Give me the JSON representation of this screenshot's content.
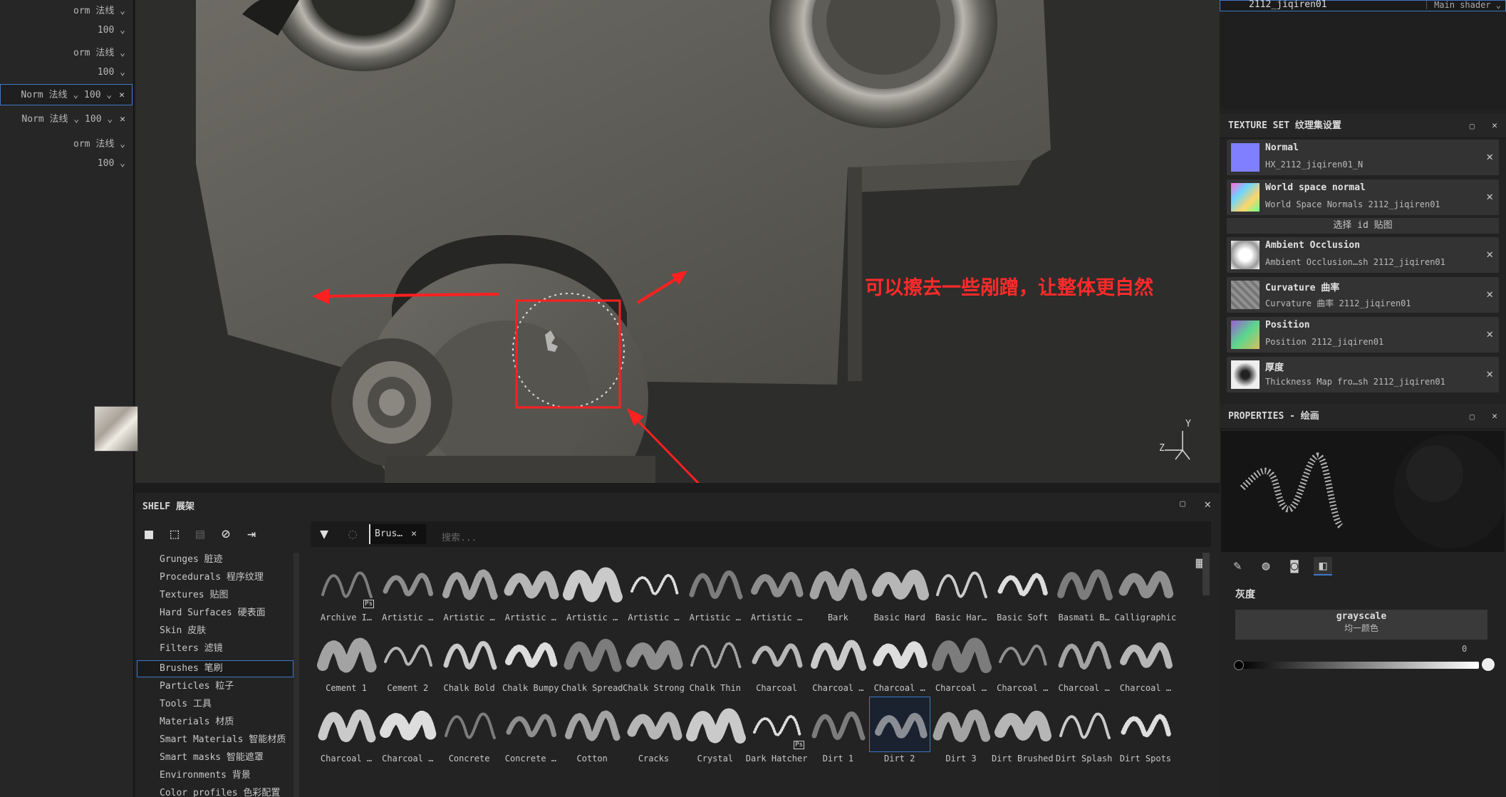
{
  "left_panel": {
    "rows": [
      {
        "text": "orm 法线 ⌄",
        "close": ""
      },
      {
        "text": "100 ⌄",
        "close": ""
      },
      {
        "text": "orm 法线 ⌄",
        "close": ""
      },
      {
        "text": "100 ⌄",
        "close": ""
      },
      {
        "text": "Norm 法线 ⌄   100 ⌄",
        "close": "✕"
      },
      {
        "text": "Norm 法线 ⌄   100 ⌄",
        "close": "✕"
      },
      {
        "text": "orm 法线 ⌄",
        "close": ""
      },
      {
        "text": "100 ⌄",
        "close": ""
      }
    ]
  },
  "viewport": {
    "annotation": "可以擦去一些剐蹭，让整体更自然",
    "axis_y": "Y",
    "axis_z": "Z"
  },
  "right_panel": {
    "top_strip": {
      "name": "2112_jiqiren01",
      "shader": "Main shader ⌄"
    },
    "texture_set": {
      "title": "TEXTURE SET 纹理集设置",
      "rows": [
        {
          "title": "Normal",
          "sub": "HX_2112_jiqiren01_N",
          "thumb_color": "#7f7fff"
        },
        {
          "title": "World space normal",
          "sub": "World Space Normals 2112_jiqiren01",
          "thumb_color": "#c060c0"
        },
        {
          "title": "Ambient Occlusion",
          "sub": "Ambient Occlusion…sh 2112_jiqiren01",
          "thumb_color": "#e8e8e8"
        },
        {
          "title": "Curvature 曲率",
          "sub": "Curvature 曲率 2112_jiqiren01",
          "thumb_color": "#8c8c8c"
        },
        {
          "title": "Position",
          "sub": "Position 2112_jiqiren01",
          "thumb_color": "#6fa86f"
        },
        {
          "title": "厚度",
          "sub": "Thickness Map fro…sh 2112_jiqiren01",
          "thumb_color": "#dcdcdc"
        }
      ],
      "select_id": "选择 id 贴图"
    },
    "properties": {
      "title": "PROPERTIES - 绘画",
      "gray_label": "灰度",
      "grayscale_button": "grayscale",
      "grayscale_sub": "均一颜色",
      "slider_value": "0"
    }
  },
  "shelf": {
    "title": "SHELF 展架",
    "categories": [
      "Grunges 脏迹",
      "Procedurals 程序纹理",
      "Textures 贴图",
      "Hard Surfaces 硬表面",
      "Skin 皮肤",
      "Filters 滤镜",
      "Brushes 笔刷",
      "Particles 粒子",
      "Tools 工具",
      "Materials 材质",
      "Smart Materials 智能材质",
      "Smart masks 智能遮罩",
      "Environments 背景",
      "Color profiles 色彩配置"
    ],
    "selected_category": "Brushes 笔刷",
    "filter_chip": "Brus…",
    "search_placeholder": "搜索...",
    "brushes_row1": [
      "Archive I…",
      "Artistic …",
      "Artistic …",
      "Artistic …",
      "Artistic …",
      "Artistic …",
      "Artistic …",
      "Artistic …",
      "Bark",
      "Basic Hard",
      "Basic Har…",
      "Basic Soft",
      "Basmati B…",
      "Calligraphic"
    ],
    "brushes_row2": [
      "Cement 1",
      "Cement 2",
      "Chalk Bold",
      "Chalk Bumpy",
      "Chalk Spread",
      "Chalk Strong",
      "Chalk Thin",
      "Charcoal",
      "Charcoal …",
      "Charcoal …",
      "Charcoal …",
      "Charcoal …",
      "Charcoal …",
      "Charcoal …"
    ],
    "brushes_row3": [
      "Charcoal …",
      "Charcoal …",
      "Concrete",
      "Concrete …",
      "Cotton",
      "Cracks",
      "Crystal",
      "Dark Hatcher",
      "Dirt 1",
      "Dirt 2",
      "Dirt 3",
      "Dirt Brushed",
      "Dirt Splash",
      "Dirt Spots"
    ],
    "selected_brush": "Dirt 2"
  }
}
